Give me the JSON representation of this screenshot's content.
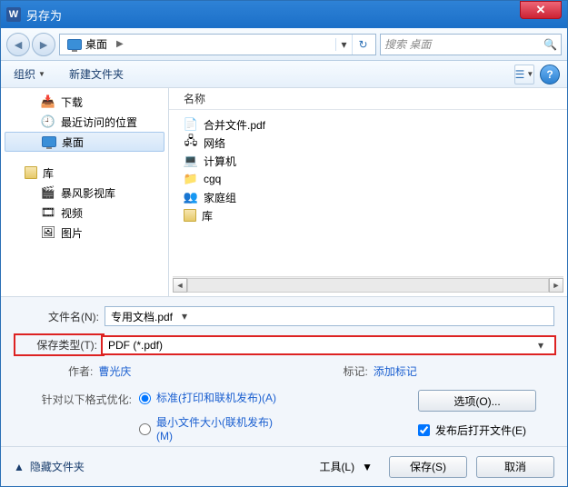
{
  "window": {
    "title": "另存为"
  },
  "nav": {
    "breadcrumb": [
      {
        "icon": "desktop",
        "label": "桌面"
      }
    ],
    "search_placeholder": "搜索 桌面"
  },
  "toolbar": {
    "organize": "组织",
    "newfolder": "新建文件夹"
  },
  "sidebar": {
    "quickAccess": [
      {
        "icon": "download",
        "label": "下载"
      },
      {
        "icon": "recent",
        "label": "最近访问的位置"
      },
      {
        "icon": "desktop",
        "label": "桌面",
        "selected": true
      }
    ],
    "libHeader": "库",
    "libs": [
      {
        "icon": "video",
        "label": "暴风影视库"
      },
      {
        "icon": "video",
        "label": "视频"
      },
      {
        "icon": "picture",
        "label": "图片"
      }
    ]
  },
  "filelist": {
    "colName": "名称",
    "items": [
      {
        "icon": "pdf",
        "label": "合并文件.pdf"
      },
      {
        "icon": "network",
        "label": "网络"
      },
      {
        "icon": "computer",
        "label": "计算机"
      },
      {
        "icon": "folder",
        "label": "cgq"
      },
      {
        "icon": "homegroup",
        "label": "家庭组"
      },
      {
        "icon": "library",
        "label": "库"
      }
    ]
  },
  "form": {
    "filenameLabel": "文件名(N):",
    "filenameValue": "专用文档.pdf",
    "typeLabel": "保存类型(T):",
    "typeValue": "PDF (*.pdf)",
    "authorLabel": "作者:",
    "authorValue": "曹光庆",
    "tagsLabel": "标记:",
    "tagsValue": "添加标记",
    "optimizeLabel": "针对以下格式优化:",
    "opt1": "标准(打印和联机发布)(A)",
    "opt2": "最小文件大小(联机发布)(M)",
    "optionsBtn": "选项(O)...",
    "openAfter": "发布后打开文件(E)"
  },
  "footer": {
    "hide": "隐藏文件夹",
    "tools": "工具(L)",
    "save": "保存(S)",
    "cancel": "取消"
  }
}
